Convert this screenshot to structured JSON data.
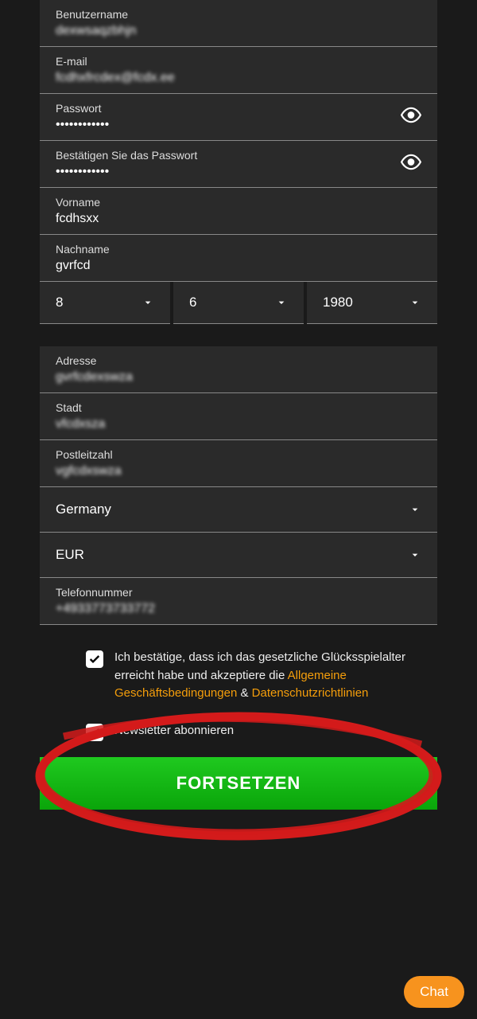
{
  "fields": {
    "username": {
      "label": "Benutzername",
      "value": "dexwsaqzbhjn"
    },
    "email": {
      "label": "E-mail",
      "value": "fcdhxfrcdex@fcdx.ee"
    },
    "password": {
      "label": "Passwort",
      "value": "••••••••••••"
    },
    "confirmPassword": {
      "label": "Bestätigen Sie das Passwort",
      "value": "••••••••••••"
    },
    "firstname": {
      "label": "Vorname",
      "value": "fcdhsxx"
    },
    "lastname": {
      "label": "Nachname",
      "value": "gvrfcd"
    },
    "address": {
      "label": "Adresse",
      "value": "gvrfcdexswza"
    },
    "city": {
      "label": "Stadt",
      "value": "vfcdxsza"
    },
    "postal": {
      "label": "Postleitzahl",
      "value": "vgfcdxswza"
    },
    "phone": {
      "label": "Telefonnummer",
      "value": "+4933773733772"
    }
  },
  "dob": {
    "day": "8",
    "month": "6",
    "year": "1980"
  },
  "country": "Germany",
  "currency": "EUR",
  "consent": {
    "prefix": "Ich bestätige, dass ich das gesetzliche Glücksspielalter erreicht habe und akzeptiere die ",
    "terms": "Allgemeine Geschäftsbedingungen",
    "and": " & ",
    "privacy": "Datenschutzrichtlinien"
  },
  "newsletter": "Newsletter abonnieren",
  "continue": "FORTSETZEN",
  "chat": "Chat"
}
